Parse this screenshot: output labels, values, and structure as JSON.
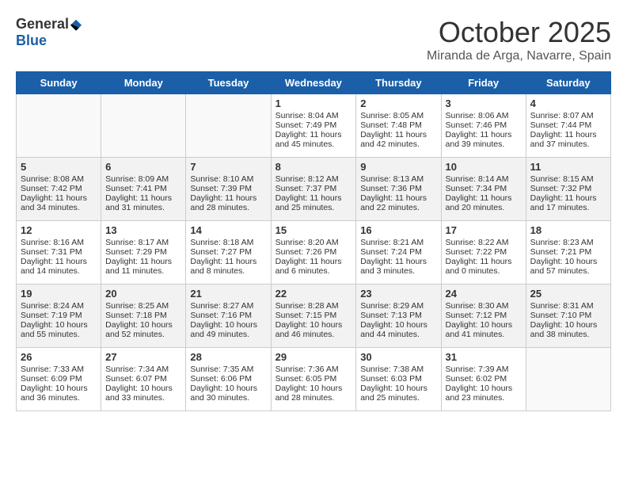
{
  "logo": {
    "general": "General",
    "blue": "Blue"
  },
  "title": "October 2025",
  "location": "Miranda de Arga, Navarre, Spain",
  "days_of_week": [
    "Sunday",
    "Monday",
    "Tuesday",
    "Wednesday",
    "Thursday",
    "Friday",
    "Saturday"
  ],
  "weeks": [
    [
      {
        "day": "",
        "content": ""
      },
      {
        "day": "",
        "content": ""
      },
      {
        "day": "",
        "content": ""
      },
      {
        "day": "1",
        "content": "Sunrise: 8:04 AM\nSunset: 7:49 PM\nDaylight: 11 hours and 45 minutes."
      },
      {
        "day": "2",
        "content": "Sunrise: 8:05 AM\nSunset: 7:48 PM\nDaylight: 11 hours and 42 minutes."
      },
      {
        "day": "3",
        "content": "Sunrise: 8:06 AM\nSunset: 7:46 PM\nDaylight: 11 hours and 39 minutes."
      },
      {
        "day": "4",
        "content": "Sunrise: 8:07 AM\nSunset: 7:44 PM\nDaylight: 11 hours and 37 minutes."
      }
    ],
    [
      {
        "day": "5",
        "content": "Sunrise: 8:08 AM\nSunset: 7:42 PM\nDaylight: 11 hours and 34 minutes."
      },
      {
        "day": "6",
        "content": "Sunrise: 8:09 AM\nSunset: 7:41 PM\nDaylight: 11 hours and 31 minutes."
      },
      {
        "day": "7",
        "content": "Sunrise: 8:10 AM\nSunset: 7:39 PM\nDaylight: 11 hours and 28 minutes."
      },
      {
        "day": "8",
        "content": "Sunrise: 8:12 AM\nSunset: 7:37 PM\nDaylight: 11 hours and 25 minutes."
      },
      {
        "day": "9",
        "content": "Sunrise: 8:13 AM\nSunset: 7:36 PM\nDaylight: 11 hours and 22 minutes."
      },
      {
        "day": "10",
        "content": "Sunrise: 8:14 AM\nSunset: 7:34 PM\nDaylight: 11 hours and 20 minutes."
      },
      {
        "day": "11",
        "content": "Sunrise: 8:15 AM\nSunset: 7:32 PM\nDaylight: 11 hours and 17 minutes."
      }
    ],
    [
      {
        "day": "12",
        "content": "Sunrise: 8:16 AM\nSunset: 7:31 PM\nDaylight: 11 hours and 14 minutes."
      },
      {
        "day": "13",
        "content": "Sunrise: 8:17 AM\nSunset: 7:29 PM\nDaylight: 11 hours and 11 minutes."
      },
      {
        "day": "14",
        "content": "Sunrise: 8:18 AM\nSunset: 7:27 PM\nDaylight: 11 hours and 8 minutes."
      },
      {
        "day": "15",
        "content": "Sunrise: 8:20 AM\nSunset: 7:26 PM\nDaylight: 11 hours and 6 minutes."
      },
      {
        "day": "16",
        "content": "Sunrise: 8:21 AM\nSunset: 7:24 PM\nDaylight: 11 hours and 3 minutes."
      },
      {
        "day": "17",
        "content": "Sunrise: 8:22 AM\nSunset: 7:22 PM\nDaylight: 11 hours and 0 minutes."
      },
      {
        "day": "18",
        "content": "Sunrise: 8:23 AM\nSunset: 7:21 PM\nDaylight: 10 hours and 57 minutes."
      }
    ],
    [
      {
        "day": "19",
        "content": "Sunrise: 8:24 AM\nSunset: 7:19 PM\nDaylight: 10 hours and 55 minutes."
      },
      {
        "day": "20",
        "content": "Sunrise: 8:25 AM\nSunset: 7:18 PM\nDaylight: 10 hours and 52 minutes."
      },
      {
        "day": "21",
        "content": "Sunrise: 8:27 AM\nSunset: 7:16 PM\nDaylight: 10 hours and 49 minutes."
      },
      {
        "day": "22",
        "content": "Sunrise: 8:28 AM\nSunset: 7:15 PM\nDaylight: 10 hours and 46 minutes."
      },
      {
        "day": "23",
        "content": "Sunrise: 8:29 AM\nSunset: 7:13 PM\nDaylight: 10 hours and 44 minutes."
      },
      {
        "day": "24",
        "content": "Sunrise: 8:30 AM\nSunset: 7:12 PM\nDaylight: 10 hours and 41 minutes."
      },
      {
        "day": "25",
        "content": "Sunrise: 8:31 AM\nSunset: 7:10 PM\nDaylight: 10 hours and 38 minutes."
      }
    ],
    [
      {
        "day": "26",
        "content": "Sunrise: 7:33 AM\nSunset: 6:09 PM\nDaylight: 10 hours and 36 minutes."
      },
      {
        "day": "27",
        "content": "Sunrise: 7:34 AM\nSunset: 6:07 PM\nDaylight: 10 hours and 33 minutes."
      },
      {
        "day": "28",
        "content": "Sunrise: 7:35 AM\nSunset: 6:06 PM\nDaylight: 10 hours and 30 minutes."
      },
      {
        "day": "29",
        "content": "Sunrise: 7:36 AM\nSunset: 6:05 PM\nDaylight: 10 hours and 28 minutes."
      },
      {
        "day": "30",
        "content": "Sunrise: 7:38 AM\nSunset: 6:03 PM\nDaylight: 10 hours and 25 minutes."
      },
      {
        "day": "31",
        "content": "Sunrise: 7:39 AM\nSunset: 6:02 PM\nDaylight: 10 hours and 23 minutes."
      },
      {
        "day": "",
        "content": ""
      }
    ]
  ]
}
